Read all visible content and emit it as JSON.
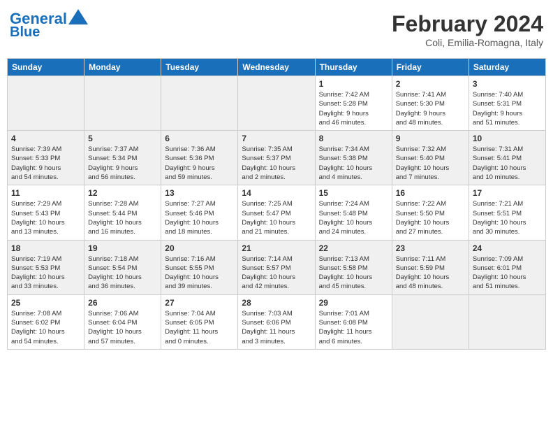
{
  "header": {
    "logo_line1": "General",
    "logo_line2": "Blue",
    "month_title": "February 2024",
    "location": "Coli, Emilia-Romagna, Italy"
  },
  "weekdays": [
    "Sunday",
    "Monday",
    "Tuesday",
    "Wednesday",
    "Thursday",
    "Friday",
    "Saturday"
  ],
  "weeks": [
    [
      {
        "day": "",
        "info": ""
      },
      {
        "day": "",
        "info": ""
      },
      {
        "day": "",
        "info": ""
      },
      {
        "day": "",
        "info": ""
      },
      {
        "day": "1",
        "info": "Sunrise: 7:42 AM\nSunset: 5:28 PM\nDaylight: 9 hours\nand 46 minutes."
      },
      {
        "day": "2",
        "info": "Sunrise: 7:41 AM\nSunset: 5:30 PM\nDaylight: 9 hours\nand 48 minutes."
      },
      {
        "day": "3",
        "info": "Sunrise: 7:40 AM\nSunset: 5:31 PM\nDaylight: 9 hours\nand 51 minutes."
      }
    ],
    [
      {
        "day": "4",
        "info": "Sunrise: 7:39 AM\nSunset: 5:33 PM\nDaylight: 9 hours\nand 54 minutes."
      },
      {
        "day": "5",
        "info": "Sunrise: 7:37 AM\nSunset: 5:34 PM\nDaylight: 9 hours\nand 56 minutes."
      },
      {
        "day": "6",
        "info": "Sunrise: 7:36 AM\nSunset: 5:36 PM\nDaylight: 9 hours\nand 59 minutes."
      },
      {
        "day": "7",
        "info": "Sunrise: 7:35 AM\nSunset: 5:37 PM\nDaylight: 10 hours\nand 2 minutes."
      },
      {
        "day": "8",
        "info": "Sunrise: 7:34 AM\nSunset: 5:38 PM\nDaylight: 10 hours\nand 4 minutes."
      },
      {
        "day": "9",
        "info": "Sunrise: 7:32 AM\nSunset: 5:40 PM\nDaylight: 10 hours\nand 7 minutes."
      },
      {
        "day": "10",
        "info": "Sunrise: 7:31 AM\nSunset: 5:41 PM\nDaylight: 10 hours\nand 10 minutes."
      }
    ],
    [
      {
        "day": "11",
        "info": "Sunrise: 7:29 AM\nSunset: 5:43 PM\nDaylight: 10 hours\nand 13 minutes."
      },
      {
        "day": "12",
        "info": "Sunrise: 7:28 AM\nSunset: 5:44 PM\nDaylight: 10 hours\nand 16 minutes."
      },
      {
        "day": "13",
        "info": "Sunrise: 7:27 AM\nSunset: 5:46 PM\nDaylight: 10 hours\nand 18 minutes."
      },
      {
        "day": "14",
        "info": "Sunrise: 7:25 AM\nSunset: 5:47 PM\nDaylight: 10 hours\nand 21 minutes."
      },
      {
        "day": "15",
        "info": "Sunrise: 7:24 AM\nSunset: 5:48 PM\nDaylight: 10 hours\nand 24 minutes."
      },
      {
        "day": "16",
        "info": "Sunrise: 7:22 AM\nSunset: 5:50 PM\nDaylight: 10 hours\nand 27 minutes."
      },
      {
        "day": "17",
        "info": "Sunrise: 7:21 AM\nSunset: 5:51 PM\nDaylight: 10 hours\nand 30 minutes."
      }
    ],
    [
      {
        "day": "18",
        "info": "Sunrise: 7:19 AM\nSunset: 5:53 PM\nDaylight: 10 hours\nand 33 minutes."
      },
      {
        "day": "19",
        "info": "Sunrise: 7:18 AM\nSunset: 5:54 PM\nDaylight: 10 hours\nand 36 minutes."
      },
      {
        "day": "20",
        "info": "Sunrise: 7:16 AM\nSunset: 5:55 PM\nDaylight: 10 hours\nand 39 minutes."
      },
      {
        "day": "21",
        "info": "Sunrise: 7:14 AM\nSunset: 5:57 PM\nDaylight: 10 hours\nand 42 minutes."
      },
      {
        "day": "22",
        "info": "Sunrise: 7:13 AM\nSunset: 5:58 PM\nDaylight: 10 hours\nand 45 minutes."
      },
      {
        "day": "23",
        "info": "Sunrise: 7:11 AM\nSunset: 5:59 PM\nDaylight: 10 hours\nand 48 minutes."
      },
      {
        "day": "24",
        "info": "Sunrise: 7:09 AM\nSunset: 6:01 PM\nDaylight: 10 hours\nand 51 minutes."
      }
    ],
    [
      {
        "day": "25",
        "info": "Sunrise: 7:08 AM\nSunset: 6:02 PM\nDaylight: 10 hours\nand 54 minutes."
      },
      {
        "day": "26",
        "info": "Sunrise: 7:06 AM\nSunset: 6:04 PM\nDaylight: 10 hours\nand 57 minutes."
      },
      {
        "day": "27",
        "info": "Sunrise: 7:04 AM\nSunset: 6:05 PM\nDaylight: 11 hours\nand 0 minutes."
      },
      {
        "day": "28",
        "info": "Sunrise: 7:03 AM\nSunset: 6:06 PM\nDaylight: 11 hours\nand 3 minutes."
      },
      {
        "day": "29",
        "info": "Sunrise: 7:01 AM\nSunset: 6:08 PM\nDaylight: 11 hours\nand 6 minutes."
      },
      {
        "day": "",
        "info": ""
      },
      {
        "day": "",
        "info": ""
      }
    ]
  ]
}
